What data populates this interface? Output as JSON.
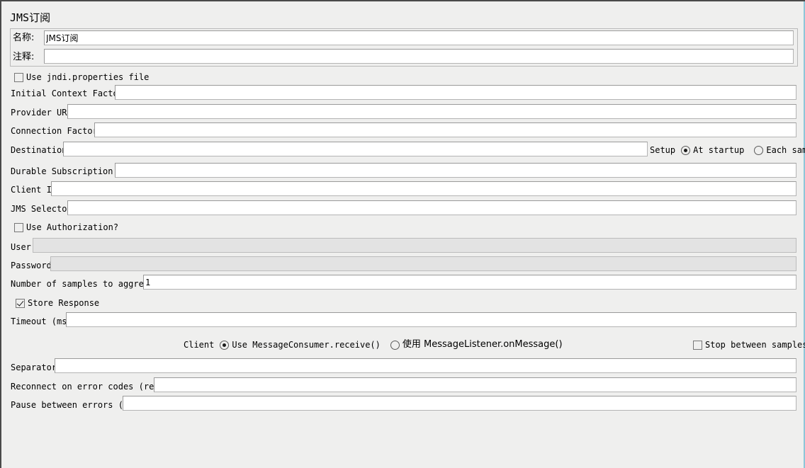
{
  "panel": {
    "title": "JMS订阅",
    "accent_color": "#8ec6d8",
    "background_color": "#efefee",
    "field_background": "#ffffff",
    "disabled_field_background": "#e3e3e3"
  },
  "name_row": {
    "label": "名称:",
    "value": "JMS订阅",
    "placeholder": ""
  },
  "comment_row": {
    "label": "注释:",
    "value": "",
    "placeholder": ""
  },
  "jndi_properties": {
    "label": "Use jndi.properties file",
    "checked": false
  },
  "initial_context_factory": {
    "label": "Initial Context Factory",
    "value": "",
    "placeholder": ""
  },
  "provider_url": {
    "label": "Provider URL",
    "value": "",
    "placeholder": ""
  },
  "connection_factory": {
    "label": "Connection Factory",
    "value": "",
    "placeholder": ""
  },
  "destination": {
    "label": "Destination",
    "value": "",
    "placeholder": ""
  },
  "setup": {
    "label": "Setup",
    "options": [
      {
        "label": "At startup",
        "selected": true
      },
      {
        "label": "Each sample",
        "selected": false
      }
    ]
  },
  "durable_subscription_id": {
    "label": "Durable Subscription ID",
    "value": "",
    "placeholder": ""
  },
  "client_id": {
    "label": "Client ID",
    "value": "",
    "placeholder": ""
  },
  "jms_selector": {
    "label": "JMS Selector",
    "value": "",
    "placeholder": ""
  },
  "use_authorization": {
    "label": "Use Authorization?",
    "checked": false
  },
  "user": {
    "label": "User",
    "value": "",
    "placeholder": "",
    "enabled": false
  },
  "password": {
    "label": "Password",
    "value": "",
    "placeholder": "",
    "enabled": false
  },
  "num_samples_to_aggregate": {
    "label": "Number of samples to aggregate",
    "value": "1",
    "placeholder": ""
  },
  "store_response": {
    "label": "Store Response",
    "checked": true
  },
  "timeout_ms": {
    "label": "Timeout (ms)",
    "value": "",
    "placeholder": ""
  },
  "client": {
    "label": "Client",
    "options": [
      {
        "label": "Use MessageConsumer.receive()",
        "selected": true
      },
      {
        "label": "使用 MessageListener.onMessage()",
        "selected": false
      }
    ]
  },
  "stop_between_samples": {
    "label": "Stop between samples?",
    "checked": false
  },
  "separator": {
    "label": "Separator",
    "value": "",
    "placeholder": ""
  },
  "reconnect_on_error_codes": {
    "label": "Reconnect on error codes (regex)",
    "value": "",
    "placeholder": ""
  },
  "pause_between_errors_ms": {
    "label": "Pause between errors (ms)",
    "value": "",
    "placeholder": ""
  }
}
